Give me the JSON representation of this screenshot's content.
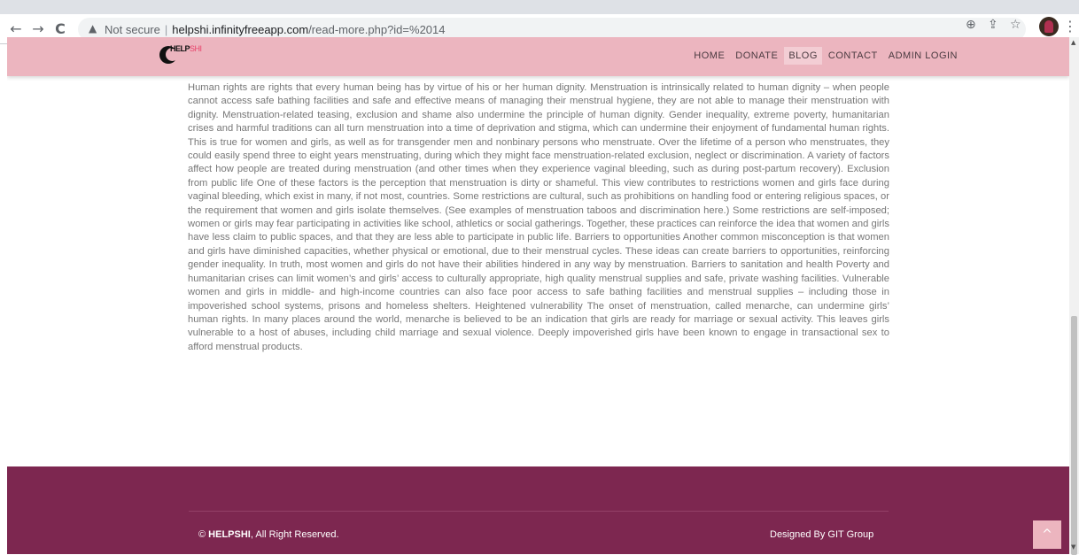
{
  "browser": {
    "back_icon": "←",
    "forward_icon": "→",
    "reload_icon": "C",
    "security_label": "Not secure",
    "url_host": "helpshi.infinityfreeapp.com",
    "url_path": "/read-more.php?id=%2014",
    "zoom_icon": "⊕",
    "share_icon": "⇪",
    "bookmark_icon": "☆",
    "menu_icon": "⋮"
  },
  "site": {
    "logo_text_a": "HELP",
    "logo_text_b": "SHI",
    "nav": [
      {
        "label": "HOME",
        "active": false
      },
      {
        "label": "DONATE",
        "active": false
      },
      {
        "label": "BLOG",
        "active": true
      },
      {
        "label": "CONTACT",
        "active": false
      },
      {
        "label": "ADMIN LOGIN",
        "active": false
      }
    ]
  },
  "article": {
    "body": "Human rights are rights that every human being has by virtue of his or her human dignity. Menstruation is intrinsically related to human dignity – when people cannot access safe bathing facilities and safe and effective means of managing their menstrual hygiene, they are not able to manage their menstruation with dignity. Menstruation-related teasing, exclusion and shame also undermine the principle of human dignity. Gender inequality, extreme poverty, humanitarian crises and harmful traditions can all turn menstruation into a time of deprivation and stigma, which can undermine their enjoyment of fundamental human rights. This is true for women and girls, as well as for transgender men and nonbinary persons who menstruate. Over the lifetime of a person who menstruates, they could easily spend three to eight years menstruating, during which they might face menstruation-related exclusion, neglect or discrimination. A variety of factors affect how people are treated during menstruation (and other times when they experience vaginal bleeding, such as during post-partum recovery). Exclusion from public life One of these factors is the perception that menstruation is dirty or shameful. This view contributes to restrictions women and girls face during vaginal bleeding, which exist in many, if not most, countries. Some restrictions are cultural, such as prohibitions on handling food or entering religious spaces, or the requirement that women and girls isolate themselves. (See examples of menstruation taboos and discrimination here.) Some restrictions are self-imposed; women or girls may fear participating in activities like school, athletics or social gatherings. Together, these practices can reinforce the idea that women and girls have less claim to public spaces, and that they are less able to participate in public life. Barriers to opportunities Another common misconception is that women and girls have diminished capacities, whether physical or emotional, due to their menstrual cycles. These ideas can create barriers to opportunities, reinforcing gender inequality. In truth, most women and girls do not have their abilities hindered in any way by menstruation. Barriers to sanitation and health Poverty and humanitarian crises can limit women’s and girls’ access to culturally appropriate, high quality menstrual supplies and safe, private washing facilities. Vulnerable women and girls in middle- and high-income countries can also face poor access to safe bathing facilities and menstrual supplies – including those in impoverished school systems, prisons and homeless shelters. Heightened vulnerability The onset of menstruation, called menarche, can undermine girls’ human rights. In many places around the world, menarche is believed to be an indication that girls are ready for marriage or sexual activity. This leaves girls vulnerable to a host of abuses, including child marriage and sexual violence. Deeply impoverished girls have been known to engage in transactional sex to afford menstrual products."
  },
  "footer": {
    "copyright_symbol": "©",
    "brand": "HELPSHI",
    "rights": ", All Right Reserved.",
    "designed_by": "Designed By GIT Group",
    "back_to_top_icon": "^"
  }
}
